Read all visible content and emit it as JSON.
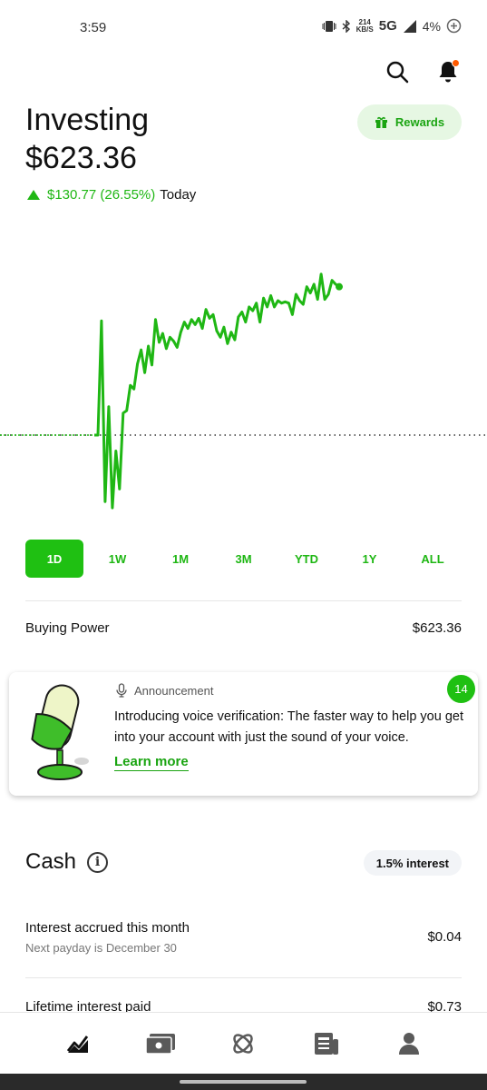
{
  "status_bar": {
    "time": "3:59",
    "speed_value": "214",
    "speed_unit": "KB/S",
    "network": "5G",
    "battery": "4%"
  },
  "header": {
    "title": "Investing",
    "balance": "$623.36",
    "change": "$130.77 (26.55%)",
    "period": "Today",
    "rewards_label": "Rewards"
  },
  "chart_data": {
    "type": "line",
    "title": "",
    "xlabel": "",
    "ylabel": "",
    "baseline": 492.59,
    "ylim": [
      420,
      650
    ],
    "color": "#1fb714",
    "x": [
      0,
      1,
      2,
      3,
      4,
      5,
      6,
      7,
      8,
      9,
      10,
      11,
      12,
      13,
      14,
      15,
      16,
      17,
      18,
      19,
      20,
      21,
      22,
      23,
      24,
      25,
      26,
      27,
      28,
      29,
      30,
      31,
      32,
      33,
      34,
      35,
      36,
      37,
      38,
      39,
      40,
      41,
      42,
      43,
      44,
      45,
      46,
      47,
      48,
      49,
      50,
      51,
      52,
      53,
      54,
      55,
      56,
      57,
      58,
      59,
      60,
      61,
      62,
      63,
      64,
      65,
      66,
      67,
      68
    ],
    "series": [
      {
        "values": [
          492.6,
          492.6,
          583,
          440,
          515,
          435,
          480,
          450,
          510,
          512,
          532,
          529,
          549,
          560,
          542,
          563,
          548,
          584,
          566,
          573,
          561,
          570,
          567,
          562,
          574,
          582,
          577,
          584,
          580,
          585,
          577,
          592,
          585,
          588,
          575,
          570,
          578,
          565,
          574,
          568,
          586,
          590,
          582,
          594,
          591,
          597,
          582,
          601,
          594,
          603,
          594,
          599,
          597,
          598,
          597,
          588,
          604,
          599,
          596,
          610,
          605,
          612,
          600,
          620,
          600,
          604,
          615,
          612,
          610
        ]
      }
    ]
  },
  "ranges": [
    "1D",
    "1W",
    "1M",
    "3M",
    "YTD",
    "1Y",
    "ALL"
  ],
  "active_range": "1D",
  "buying_power": {
    "label": "Buying Power",
    "value": "$623.36"
  },
  "announcement": {
    "heading": "Announcement",
    "text": "Introducing voice verification: The faster way to help you get into your account with just the sound of your voice.",
    "link": "Learn more",
    "badge": "14"
  },
  "cash": {
    "title": "Cash",
    "interest_pill": "1.5% interest",
    "rows": [
      {
        "label": "Interest accrued this month",
        "sub": "Next payday is December 30",
        "value": "$0.04"
      },
      {
        "label": "Lifetime interest paid",
        "value": "$0.73"
      }
    ]
  },
  "nav": {
    "items": [
      "investing-icon",
      "card-icon",
      "crypto-icon",
      "news-icon",
      "account-icon"
    ]
  }
}
